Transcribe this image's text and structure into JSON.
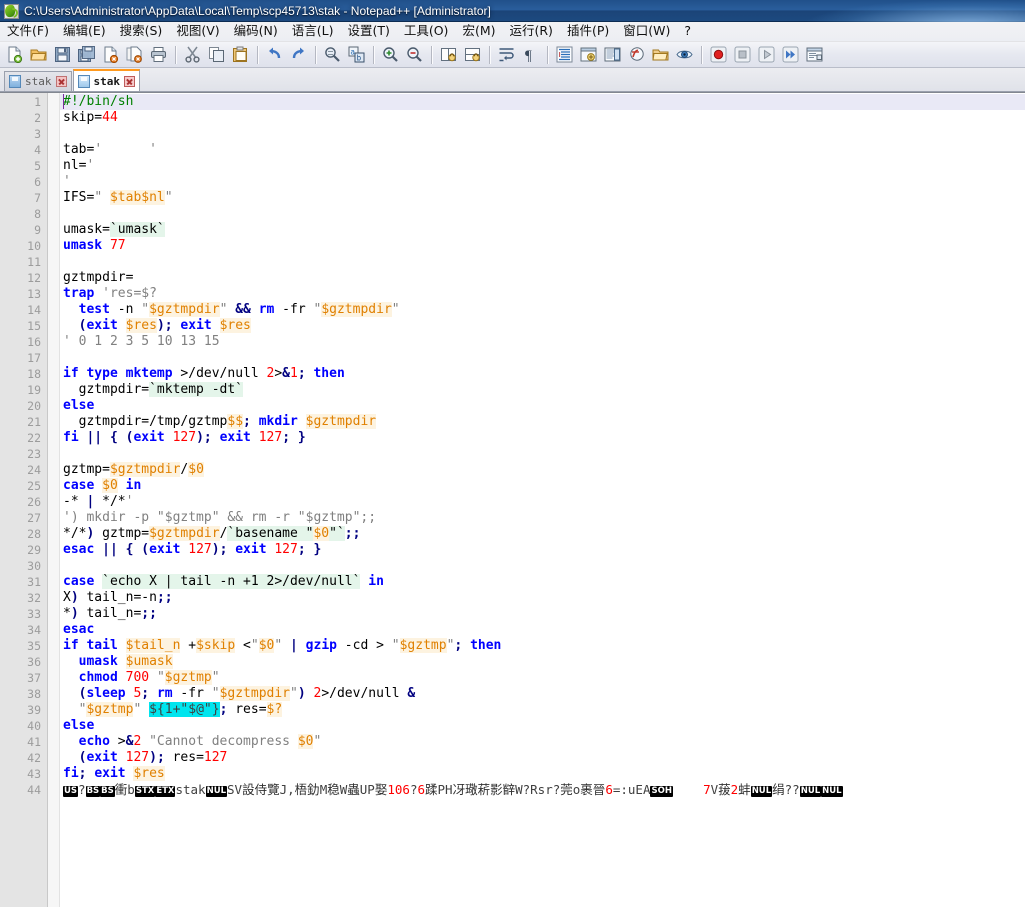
{
  "window": {
    "title": "C:\\Users\\Administrator\\AppData\\Local\\Temp\\scp45713\\stak - Notepad++ [Administrator]",
    "app_icon": "notepad-plus-plus-icon"
  },
  "menu": {
    "items": [
      {
        "label": "文件(F)",
        "name": "menu-file"
      },
      {
        "label": "编辑(E)",
        "name": "menu-edit"
      },
      {
        "label": "搜索(S)",
        "name": "menu-search"
      },
      {
        "label": "视图(V)",
        "name": "menu-view"
      },
      {
        "label": "编码(N)",
        "name": "menu-encoding"
      },
      {
        "label": "语言(L)",
        "name": "menu-language"
      },
      {
        "label": "设置(T)",
        "name": "menu-settings"
      },
      {
        "label": "工具(O)",
        "name": "menu-tools"
      },
      {
        "label": "宏(M)",
        "name": "menu-macro"
      },
      {
        "label": "运行(R)",
        "name": "menu-run"
      },
      {
        "label": "插件(P)",
        "name": "menu-plugins"
      },
      {
        "label": "窗口(W)",
        "name": "menu-window"
      },
      {
        "label": "?",
        "name": "menu-help"
      }
    ]
  },
  "toolbar": {
    "buttons": [
      {
        "icon": "new-file-icon"
      },
      {
        "icon": "open-file-icon"
      },
      {
        "icon": "save-icon"
      },
      {
        "icon": "save-all-icon"
      },
      {
        "icon": "close-file-icon"
      },
      {
        "icon": "close-all-icon"
      },
      {
        "icon": "print-icon"
      },
      {
        "sep": true
      },
      {
        "icon": "cut-icon"
      },
      {
        "icon": "copy-icon"
      },
      {
        "icon": "paste-icon"
      },
      {
        "sep": true
      },
      {
        "icon": "undo-icon"
      },
      {
        "icon": "redo-icon"
      },
      {
        "sep": true
      },
      {
        "icon": "find-icon"
      },
      {
        "icon": "replace-icon"
      },
      {
        "sep": true
      },
      {
        "icon": "zoom-in-icon"
      },
      {
        "icon": "zoom-out-icon"
      },
      {
        "sep": true
      },
      {
        "icon": "sync-vertical-scroll-icon"
      },
      {
        "icon": "sync-horizontal-scroll-icon"
      },
      {
        "sep": true
      },
      {
        "icon": "word-wrap-icon"
      },
      {
        "icon": "show-all-characters-icon"
      },
      {
        "sep": true
      },
      {
        "icon": "indent-guideline-icon"
      },
      {
        "icon": "user-defined-dialog-icon"
      },
      {
        "icon": "document-map-icon"
      },
      {
        "icon": "function-list-icon"
      },
      {
        "icon": "folder-as-workspace-icon"
      },
      {
        "icon": "monitoring-icon"
      },
      {
        "sep": true
      },
      {
        "icon": "record-macro-icon"
      },
      {
        "icon": "stop-recording-icon"
      },
      {
        "icon": "play-macro-icon"
      },
      {
        "icon": "run-macro-multiple-icon"
      },
      {
        "icon": "run-dialog-icon"
      }
    ]
  },
  "tabs": [
    {
      "label": "stak",
      "active": false,
      "name": "tab-stak-1"
    },
    {
      "label": "stak",
      "active": true,
      "name": "tab-stak-2"
    }
  ],
  "editor": {
    "current_line": 1,
    "total_lines": 44,
    "selection_text": "${1+\"$@\"}",
    "lines": [
      {
        "n": 1,
        "text": "#!/bin/sh"
      },
      {
        "n": 2,
        "text": "skip=44"
      },
      {
        "n": 3,
        "text": ""
      },
      {
        "n": 4,
        "text": "tab='\t'"
      },
      {
        "n": 5,
        "text": "nl='"
      },
      {
        "n": 6,
        "text": "'"
      },
      {
        "n": 7,
        "text": "IFS=\" $tab$nl\""
      },
      {
        "n": 8,
        "text": ""
      },
      {
        "n": 9,
        "text": "umask=`umask`"
      },
      {
        "n": 10,
        "text": "umask 77"
      },
      {
        "n": 11,
        "text": ""
      },
      {
        "n": 12,
        "text": "gztmpdir="
      },
      {
        "n": 13,
        "text": "trap 'res=$?"
      },
      {
        "n": 14,
        "text": "  test -n \"$gztmpdir\" && rm -fr \"$gztmpdir\""
      },
      {
        "n": 15,
        "text": "  (exit $res); exit $res"
      },
      {
        "n": 16,
        "text": "' 0 1 2 3 5 10 13 15"
      },
      {
        "n": 17,
        "text": ""
      },
      {
        "n": 18,
        "text": "if type mktemp >/dev/null 2>&1; then"
      },
      {
        "n": 19,
        "text": "  gztmpdir=`mktemp -dt`"
      },
      {
        "n": 20,
        "text": "else"
      },
      {
        "n": 21,
        "text": "  gztmpdir=/tmp/gztmp$$; mkdir $gztmpdir"
      },
      {
        "n": 22,
        "text": "fi || { (exit 127); exit 127; }"
      },
      {
        "n": 23,
        "text": ""
      },
      {
        "n": 24,
        "text": "gztmp=$gztmpdir/$0"
      },
      {
        "n": 25,
        "text": "case $0 in"
      },
      {
        "n": 26,
        "text": "-* | */*'"
      },
      {
        "n": 27,
        "text": "') mkdir -p \"$gztmp\" && rm -r \"$gztmp\";;"
      },
      {
        "n": 28,
        "text": "*/*) gztmp=$gztmpdir/`basename \"$0\"`;;"
      },
      {
        "n": 29,
        "text": "esac || { (exit 127); exit 127; }"
      },
      {
        "n": 30,
        "text": ""
      },
      {
        "n": 31,
        "text": "case `echo X | tail -n +1 2>/dev/null` in"
      },
      {
        "n": 32,
        "text": "X) tail_n=-n;;"
      },
      {
        "n": 33,
        "text": "*) tail_n=;;"
      },
      {
        "n": 34,
        "text": "esac"
      },
      {
        "n": 35,
        "text": "if tail $tail_n +$skip <\"$0\" | gzip -cd > \"$gztmp\"; then"
      },
      {
        "n": 36,
        "text": "  umask $umask"
      },
      {
        "n": 37,
        "text": "  chmod 700 \"$gztmp\""
      },
      {
        "n": 38,
        "text": "  (sleep 5; rm -fr \"$gztmpdir\") 2>/dev/null &"
      },
      {
        "n": 39,
        "text": "  \"$gztmp\" ${1+\"$@\"}; res=$?"
      },
      {
        "n": 40,
        "text": "else"
      },
      {
        "n": 41,
        "text": "  echo >&2 \"Cannot decompress $0\""
      },
      {
        "n": 42,
        "text": "  (exit 127); res=127"
      },
      {
        "n": 43,
        "text": "fi; exit $res"
      },
      {
        "n": 44,
        "text": "binary-data-line"
      }
    ],
    "binary_line": {
      "segments": [
        {
          "kind": "ctrl",
          "text": "US"
        },
        {
          "kind": "plain",
          "text": "?"
        },
        {
          "kind": "ctrl",
          "text": "BS"
        },
        {
          "kind": "ctrl",
          "text": "BS"
        },
        {
          "kind": "cjk",
          "text": "衝"
        },
        {
          "kind": "plain",
          "text": "b"
        },
        {
          "kind": "ctrl",
          "text": "STX"
        },
        {
          "kind": "ctrl",
          "text": "ETX"
        },
        {
          "kind": "plain",
          "text": "stak"
        },
        {
          "kind": "ctrl",
          "text": "NUL"
        },
        {
          "kind": "plain",
          "text": "SV"
        },
        {
          "kind": "cjk",
          "text": "設侍覽"
        },
        {
          "kind": "plain",
          "text": "J,"
        },
        {
          "kind": "cjk",
          "text": "梧釛"
        },
        {
          "kind": "plain",
          "text": "M"
        },
        {
          "kind": "cjk",
          "text": "稳"
        },
        {
          "kind": "plain",
          "text": "W"
        },
        {
          "kind": "cjk",
          "text": "蟲"
        },
        {
          "kind": "plain",
          "text": "UP"
        },
        {
          "kind": "cjk",
          "text": "娶"
        },
        {
          "kind": "num",
          "text": "106"
        },
        {
          "kind": "plain",
          "text": "?"
        },
        {
          "kind": "num",
          "text": "6"
        },
        {
          "kind": "cjk",
          "text": "蹂"
        },
        {
          "kind": "plain",
          "text": "PH"
        },
        {
          "kind": "cjk",
          "text": "冴璥菥影辥"
        },
        {
          "kind": "plain",
          "text": "W?Rsr?"
        },
        {
          "kind": "cjk",
          "text": "莞"
        },
        {
          "kind": "plain",
          "text": "o"
        },
        {
          "kind": "cjk",
          "text": "裹晉"
        },
        {
          "kind": "num",
          "text": "6"
        },
        {
          "kind": "plain",
          "text": "=:uEA"
        },
        {
          "kind": "ctrl",
          "text": "SOH"
        },
        {
          "kind": "plain",
          "text": "    "
        },
        {
          "kind": "num",
          "text": "7"
        },
        {
          "kind": "plain",
          "text": "V"
        },
        {
          "kind": "cjk",
          "text": "菝"
        },
        {
          "kind": "num",
          "text": "2"
        },
        {
          "kind": "cjk",
          "text": "蚌"
        },
        {
          "kind": "ctrl",
          "text": "NUL"
        },
        {
          "kind": "cjk",
          "text": "绢"
        },
        {
          "kind": "plain",
          "text": "??"
        },
        {
          "kind": "ctrl",
          "text": "NUL"
        },
        {
          "kind": "ctrl",
          "text": "NUL"
        }
      ]
    }
  },
  "colors": {
    "titlebar": "#20508a",
    "comment": "#008000",
    "keyword": "#0000ff",
    "number": "#ff0000",
    "string": "#808080",
    "variable": "#e08000",
    "variable_bg": "#fdf3e0",
    "backtick_bg": "#e4f5ea",
    "selection": "#00e5ee",
    "current_line_bg": "#e9e9f6",
    "gutter_bg": "#e4e4e4",
    "tab_active_border": "#ff9a1f"
  }
}
